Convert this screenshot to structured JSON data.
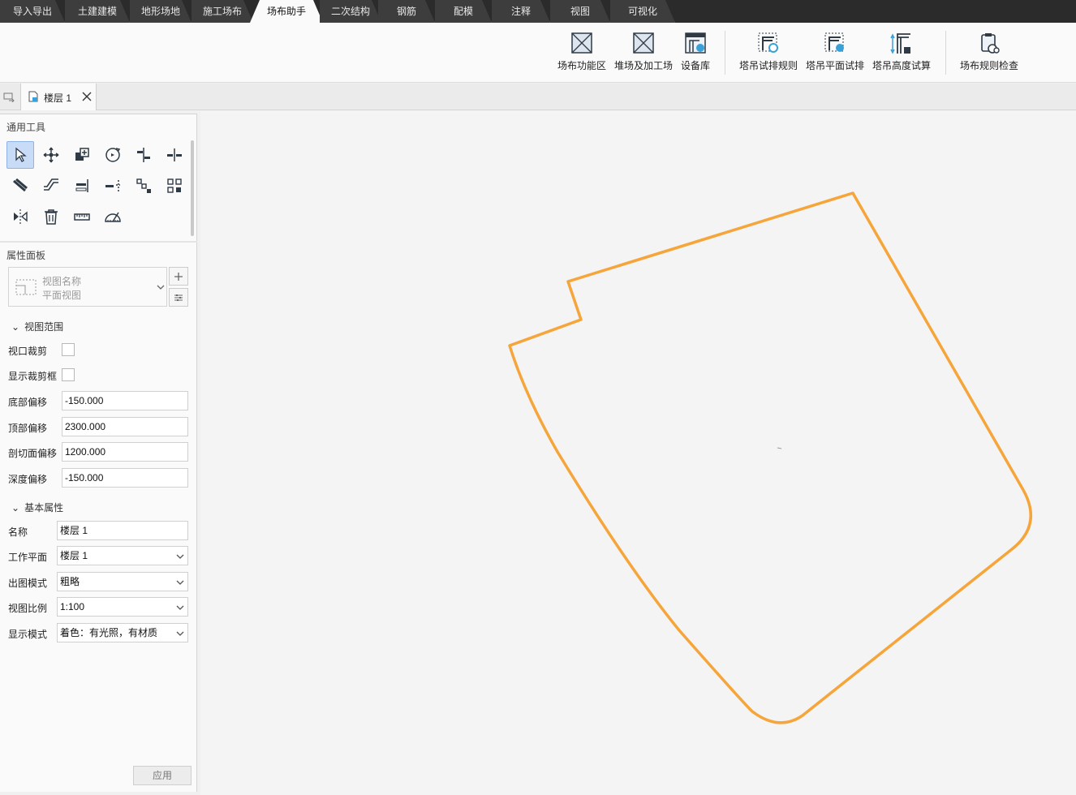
{
  "tabs": [
    {
      "label": "导入导出",
      "active": false
    },
    {
      "label": "土建建模",
      "active": false
    },
    {
      "label": "地形场地",
      "active": false
    },
    {
      "label": "施工场布",
      "active": false
    },
    {
      "label": "场布助手",
      "active": true
    },
    {
      "label": "二次结构",
      "active": false
    },
    {
      "label": "钢筋",
      "active": false
    },
    {
      "label": "配模",
      "active": false
    },
    {
      "label": "注释",
      "active": false
    },
    {
      "label": "视图",
      "active": false
    },
    {
      "label": "可视化",
      "active": false
    }
  ],
  "ribbon": {
    "buttons": [
      {
        "label": "场布功能区",
        "icon": "function-zone-icon"
      },
      {
        "label": "堆场及加工场",
        "icon": "yard-icon"
      },
      {
        "label": "设备库",
        "icon": "equipment-library-icon"
      },
      {
        "label": "塔吊试排规则",
        "icon": "crane-rule-icon"
      },
      {
        "label": "塔吊平面试排",
        "icon": "crane-plan-icon"
      },
      {
        "label": "塔吊高度试算",
        "icon": "crane-height-icon"
      },
      {
        "label": "场布规则检查",
        "icon": "rule-check-icon"
      }
    ]
  },
  "doc_tab": {
    "label": "楼层 1"
  },
  "tools": {
    "title": "通用工具",
    "items": [
      "select-icon",
      "move-icon",
      "copy-icon",
      "rotate-icon",
      "align-icon",
      "split-icon",
      "offset-icon",
      "trim-icon",
      "extend-icon",
      "break-icon",
      "array-icon",
      "group-icon",
      "mirror-icon",
      "delete-icon",
      "measure-icon",
      "angle-measure-icon"
    ]
  },
  "properties": {
    "title": "属性面板",
    "view_name_label": "视图名称",
    "view_type": "平面视图",
    "view_range": {
      "title": "视图范围",
      "viewport_crop": "视口裁剪",
      "show_crop_frame": "显示裁剪框",
      "bottom_offset_label": "底部偏移",
      "bottom_offset": "-150.000",
      "top_offset_label": "顶部偏移",
      "top_offset": "2300.000",
      "cut_offset_label": "剖切面偏移",
      "cut_offset": "1200.000",
      "depth_offset_label": "深度偏移",
      "depth_offset": "-150.000"
    },
    "basic": {
      "title": "基本属性",
      "name_label": "名称",
      "name": "楼层 1",
      "workplane_label": "工作平面",
      "workplane": "楼层 1",
      "output_mode_label": "出图模式",
      "output_mode": "粗略",
      "scale_label": "视图比例",
      "scale": "1:100",
      "display_mode_label": "显示模式",
      "display_mode": "着色：有光照，有材质"
    },
    "apply_label": "应用"
  },
  "canvas": {
    "outline_color": "#f5a53a",
    "background": "#f4f4f4"
  }
}
